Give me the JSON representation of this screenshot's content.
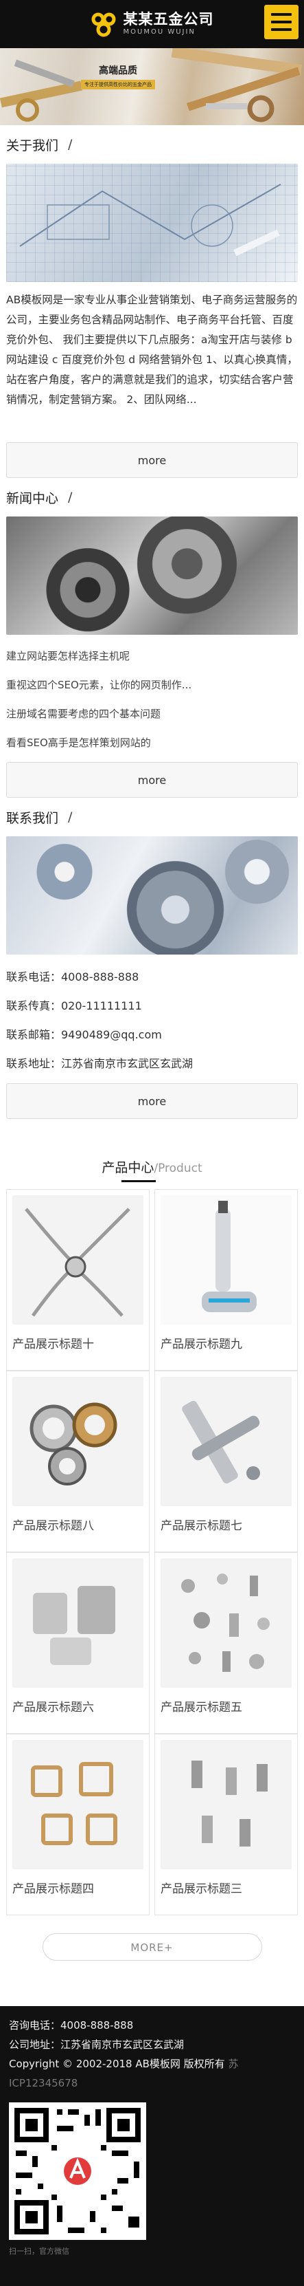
{
  "header": {
    "company_name": "某某五金公司",
    "company_sub": "MOUMOU WUJIN"
  },
  "banner": {
    "caption_title": "高端品质",
    "caption_sub": "专注于提供高性价比的五金产品"
  },
  "about": {
    "title": "关于我们",
    "slash": "/",
    "text": "AB模板网是一家专业从事企业营销策划、电子商务运营服务的公司，主要业务包含精品网站制作、电子商务平台托管、百度竞价外包、 我们主要提供以下几点服务：a淘宝开店与装修 b 网站建设 c 百度竞价外包 d 网络营销外包 1、以真心换真情，站在客户角度，客户的满意就是我们的追求，切实结合客户营销情况，制定营销方案。 2、团队网络...",
    "more": "more"
  },
  "news": {
    "title": "新闻中心",
    "slash": "/",
    "items": [
      "建立网站要怎样选择主机呢",
      "重视这四个SEO元素，让你的网页制作...",
      "注册域名需要考虑的四个基本问题",
      "看看SEO高手是怎样策划网站的"
    ],
    "more": "more"
  },
  "contact": {
    "title": "联系我们",
    "slash": "/",
    "items": [
      "联系电话：4008-888-888",
      "联系传真：020-11111111",
      "联系邮箱：9490489@qq.com",
      "联系地址：江苏省南京市玄武区玄武湖"
    ],
    "more": "more"
  },
  "products": {
    "title_cn": "产品中心",
    "title_en": "/Product",
    "items": [
      "产品展示标题十",
      "产品展示标题九",
      "产品展示标题八",
      "产品展示标题七",
      "产品展示标题六",
      "产品展示标题五",
      "产品展示标题四",
      "产品展示标题三"
    ],
    "more": "MORE+"
  },
  "footer": {
    "phone": "咨询电话：4008-888-888",
    "address": "公司地址：江苏省南京市玄武区玄武湖",
    "copyright": "Copyright © 2002-2018 AB模板网 版权所有",
    "icp_prefix": "苏",
    "icp_number": "ICP12345678",
    "qr_caption": "扫一扫，官方微信"
  },
  "icons": {
    "logo": "logo-icon",
    "menu": "menu-icon",
    "qr": "qr-code-icon"
  },
  "colors": {
    "accent": "#f4c20d",
    "header_bg": "#0f0f0f",
    "footer_bg": "#111111"
  }
}
